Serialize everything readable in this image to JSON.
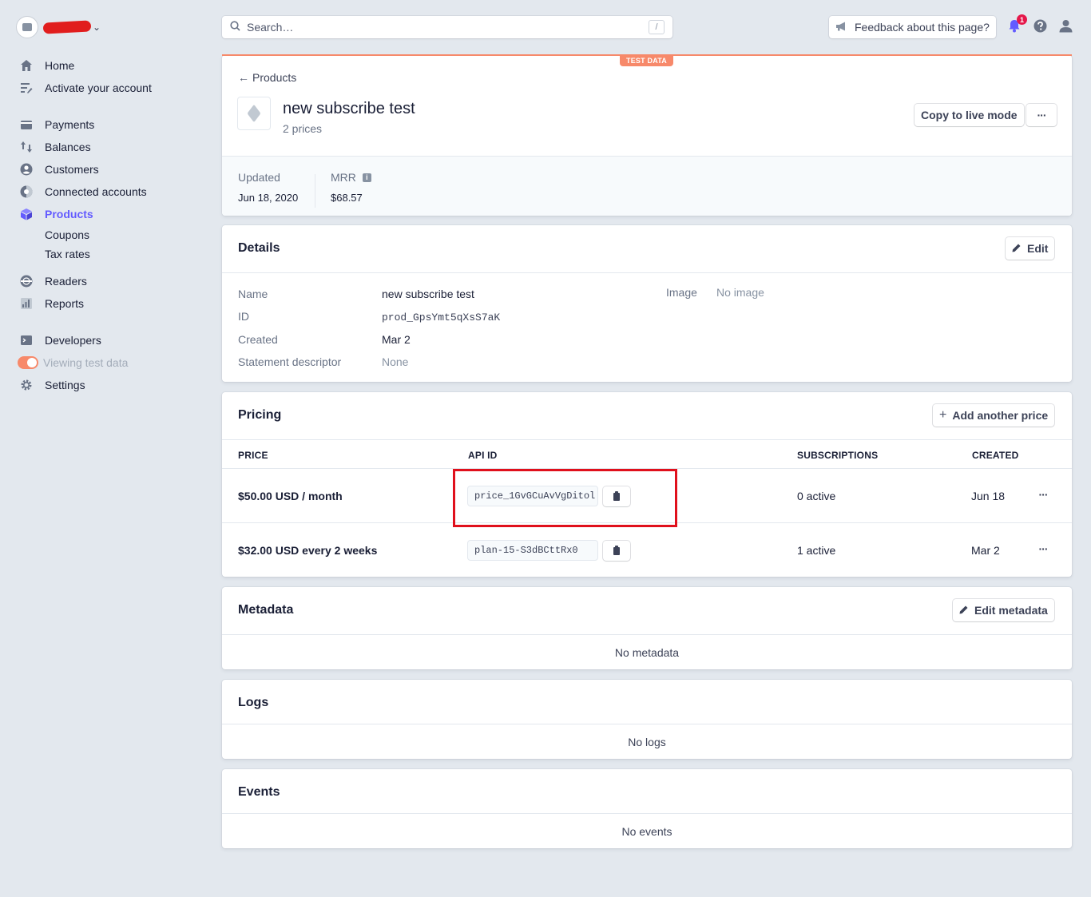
{
  "sidebar": {
    "items": [
      {
        "label": "Home",
        "icon": "home-icon"
      },
      {
        "label": "Activate your account",
        "icon": "checklist-icon"
      },
      {
        "label": "Payments",
        "icon": "payments-icon"
      },
      {
        "label": "Balances",
        "icon": "balances-icon"
      },
      {
        "label": "Customers",
        "icon": "customers-icon"
      },
      {
        "label": "Connected accounts",
        "icon": "connected-accounts-icon"
      },
      {
        "label": "Products",
        "icon": "products-icon",
        "active": true
      },
      {
        "label": "Coupons"
      },
      {
        "label": "Tax rates"
      },
      {
        "label": "Readers",
        "icon": "readers-icon"
      },
      {
        "label": "Reports",
        "icon": "reports-icon"
      },
      {
        "label": "Developers",
        "icon": "developers-icon"
      },
      {
        "label": "Viewing test data",
        "icon": "toggle"
      },
      {
        "label": "Settings",
        "icon": "gear-icon"
      }
    ]
  },
  "topbar": {
    "search_placeholder": "Search…",
    "search_shortcut": "/",
    "feedback_label": "Feedback about this page?",
    "notification_count": "1"
  },
  "header": {
    "test_badge": "TEST DATA",
    "back_label": "Products",
    "title": "new subscribe test",
    "subtitle": "2 prices",
    "copy_live_label": "Copy to live mode",
    "more_label": "···",
    "updated_label": "Updated",
    "updated_value": "Jun 18, 2020",
    "mrr_label": "MRR",
    "mrr_value": "$68.57"
  },
  "details": {
    "title": "Details",
    "edit_label": "Edit",
    "name_label": "Name",
    "name_value": "new subscribe test",
    "id_label": "ID",
    "id_value": "prod_GpsYmt5qXsS7aK",
    "created_label": "Created",
    "created_value": "Mar 2",
    "descriptor_label": "Statement descriptor",
    "descriptor_value": "None",
    "image_label": "Image",
    "image_value": "No image"
  },
  "pricing": {
    "title": "Pricing",
    "add_label": "Add another price",
    "columns": [
      "PRICE",
      "API ID",
      "SUBSCRIPTIONS",
      "CREATED"
    ],
    "rows": [
      {
        "price": "$50.00 USD / month",
        "api_id": "price_1GvGCuAvVgDitol",
        "subscriptions": "0 active",
        "created": "Jun 18"
      },
      {
        "price": "$32.00 USD every 2 weeks",
        "api_id": "plan-15-S3dBCttRx0",
        "subscriptions": "1 active",
        "created": "Mar 2"
      }
    ]
  },
  "metadata": {
    "title": "Metadata",
    "edit_label": "Edit metadata",
    "empty": "No metadata"
  },
  "logs": {
    "title": "Logs",
    "empty": "No logs"
  },
  "events": {
    "title": "Events",
    "empty": "No events"
  },
  "colors": {
    "accent": "#635bff",
    "test_mode": "#f7896a",
    "highlight": "#e0101c"
  }
}
